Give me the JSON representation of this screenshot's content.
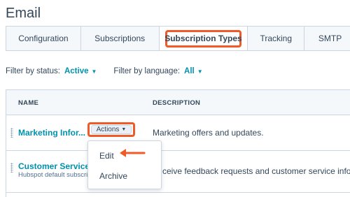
{
  "page": {
    "title": "Email"
  },
  "tabs": [
    {
      "label": "Configuration",
      "active": false
    },
    {
      "label": "Subscriptions",
      "active": false
    },
    {
      "label": "Subscription Types",
      "active": true
    },
    {
      "label": "Tracking",
      "active": false
    },
    {
      "label": "SMTP",
      "active": false
    }
  ],
  "filters": {
    "status_label": "Filter by status:",
    "status_value": "Active",
    "language_label": "Filter by language:",
    "language_value": "All"
  },
  "table": {
    "headers": {
      "name": "NAME",
      "description": "DESCRIPTION"
    },
    "rows": [
      {
        "name": "Marketing Infor...",
        "description": "Marketing offers and updates."
      },
      {
        "name": "Customer Service C",
        "subtitle": "Hubspot default subscrip",
        "description": "ceive feedback requests and customer service infor..."
      }
    ]
  },
  "actions": {
    "label": "Actions"
  },
  "dropdown": {
    "items": [
      "Edit",
      "Archive"
    ]
  },
  "colors": {
    "accent": "#0091ae",
    "highlight": "#f05a28",
    "text": "#33475b",
    "border": "#cbd6e2"
  },
  "icons": [
    "caret-down-icon",
    "drag-handle-icon",
    "arrow-left-icon"
  ]
}
